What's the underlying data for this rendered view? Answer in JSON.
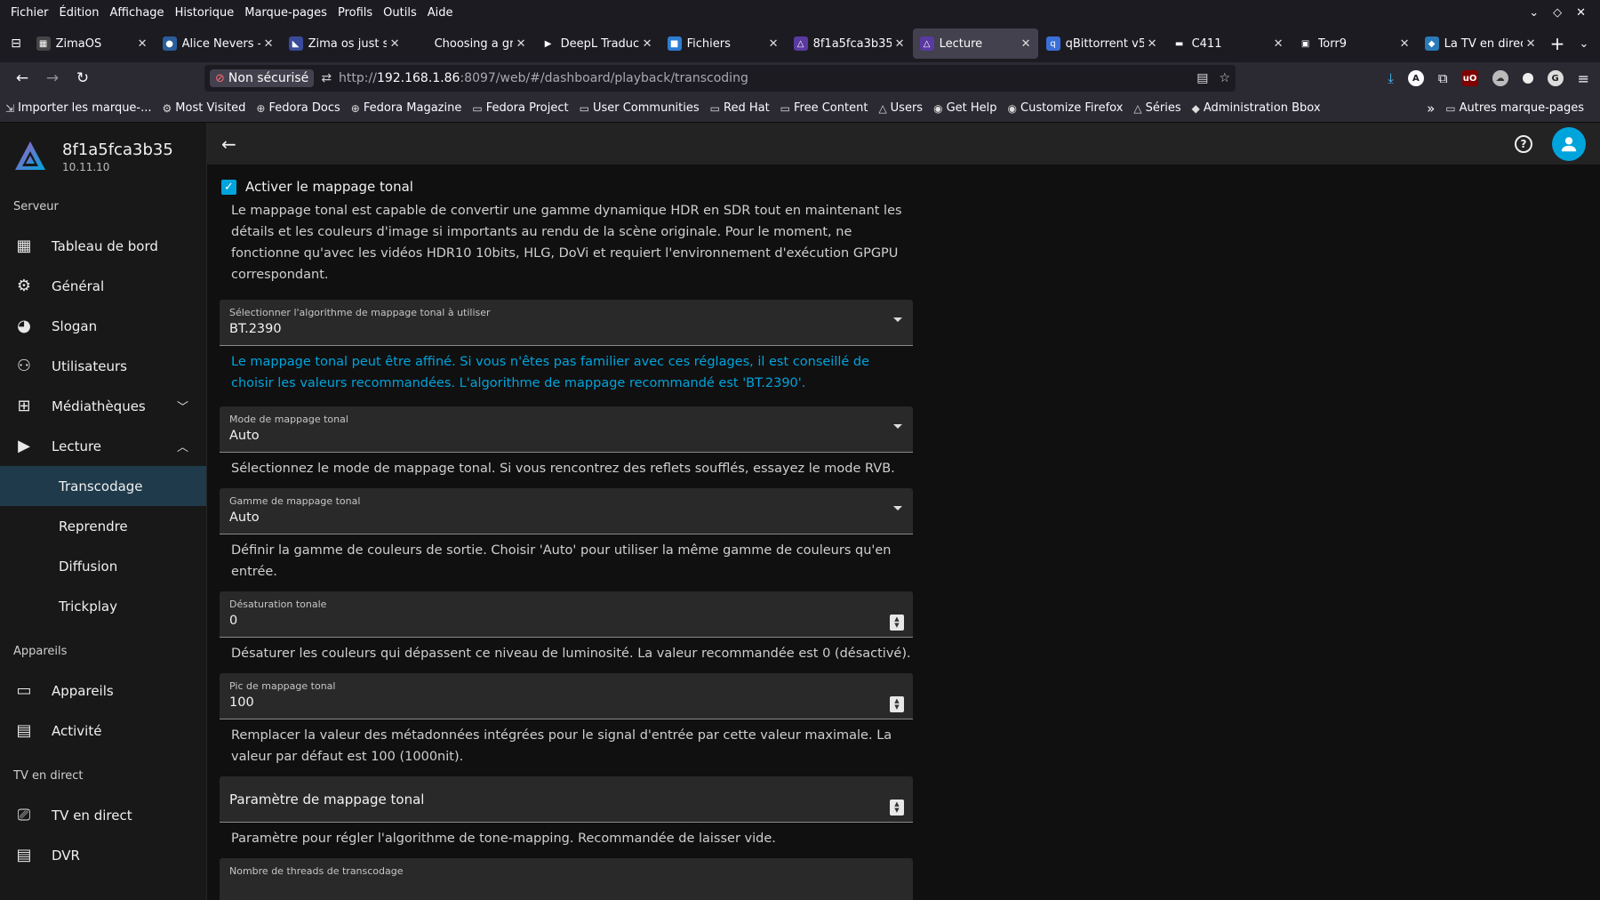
{
  "menubar": [
    "Fichier",
    "Édition",
    "Affichage",
    "Historique",
    "Marque-pages",
    "Profils",
    "Outils",
    "Aide"
  ],
  "tabs": [
    {
      "title": "ZimaOS",
      "fav_color": "#444",
      "fav_glyph": "▦",
      "active": false
    },
    {
      "title": "Alice Nevers -",
      "fav_color": "#2a5d9a",
      "fav_glyph": "●",
      "active": false
    },
    {
      "title": "Zima os just s",
      "fav_color": "#3a4a9a",
      "fav_glyph": "◣",
      "active": false
    },
    {
      "title": "Choosing a gr",
      "fav_color": "#1c1b22",
      "fav_glyph": "",
      "active": false
    },
    {
      "title": "DeepL Traduc",
      "fav_color": "#1c1b22",
      "fav_glyph": "▶",
      "active": false
    },
    {
      "title": "Fichiers",
      "fav_color": "#2d7dd2",
      "fav_glyph": "■",
      "active": false
    },
    {
      "title": "8f1a5fca3b35",
      "fav_color": "#5a3aa0",
      "fav_glyph": "△",
      "active": false
    },
    {
      "title": "Lecture",
      "fav_color": "#5a3aa0",
      "fav_glyph": "△",
      "active": true
    },
    {
      "title": "qBittorrent v5",
      "fav_color": "#3a6fd8",
      "fav_glyph": "q",
      "active": false
    },
    {
      "title": "C411",
      "fav_color": "#1c1b22",
      "fav_glyph": "▬",
      "active": false
    },
    {
      "title": "Torr9",
      "fav_color": "#1c1b22",
      "fav_glyph": "▣",
      "active": false
    },
    {
      "title": "La TV en direc",
      "fav_color": "#2a7ab8",
      "fav_glyph": "◆",
      "active": false
    }
  ],
  "navbar": {
    "insecure_label": "Non sécurisé",
    "url_prefix": "http://",
    "url_host": "192.168.1.86",
    "url_rest": ":8097/web/#/dashboard/playback/transcoding"
  },
  "bookmarks": [
    {
      "label": "Importer les marque-...",
      "icon": "⇲"
    },
    {
      "label": "Most Visited",
      "icon": "⚙"
    },
    {
      "label": "Fedora Docs",
      "icon": "⊕"
    },
    {
      "label": "Fedora Magazine",
      "icon": "⊕"
    },
    {
      "label": "Fedora Project",
      "icon": "▭"
    },
    {
      "label": "User Communities",
      "icon": "▭"
    },
    {
      "label": "Red Hat",
      "icon": "▭"
    },
    {
      "label": "Free Content",
      "icon": "▭"
    },
    {
      "label": "Users",
      "icon": "△"
    },
    {
      "label": "Get Help",
      "icon": "◉"
    },
    {
      "label": "Customize Firefox",
      "icon": "◉"
    },
    {
      "label": "Séries",
      "icon": "△"
    },
    {
      "label": "Administration Bbox",
      "icon": "◆"
    }
  ],
  "bookmarks_other": "Autres marque-pages",
  "server": {
    "name": "8f1a5fca3b35",
    "version": "10.11.10"
  },
  "sidebar": {
    "section_server": "Serveur",
    "items": [
      {
        "label": "Tableau de bord",
        "icon": "▦"
      },
      {
        "label": "Général",
        "icon": "⚙"
      },
      {
        "label": "Slogan",
        "icon": "🎨"
      },
      {
        "label": "Utilisateurs",
        "icon": "👥"
      },
      {
        "label": "Médiathèques",
        "icon": "⊞"
      },
      {
        "label": "Lecture",
        "icon": "▶"
      }
    ],
    "sub_items": [
      "Transcodage",
      "Reprendre",
      "Diffusion",
      "Trickplay"
    ],
    "section_devices": "Appareils",
    "device_items": [
      {
        "label": "Appareils",
        "icon": "▭"
      },
      {
        "label": "Activité",
        "icon": "▤"
      }
    ],
    "section_tv": "TV en direct",
    "tv_items": [
      {
        "label": "TV en direct",
        "icon": "📺"
      },
      {
        "label": "DVR",
        "icon": "▤"
      }
    ]
  },
  "content": {
    "checkbox_label": "Activer le mappage tonal",
    "checkbox_desc": "Le mappage tonal est capable de convertir une gamme dynamique HDR en SDR tout en maintenant les détails et les couleurs d'image si importants au rendu de la scène originale. Pour le moment, ne fonctionne qu'avec les vidéos HDR10 10bits, HLG, DoVi et requiert l'environnement d'exécution GPGPU correspondant.",
    "algo_label": "Sélectionner l'algorithme de mappage tonal à utiliser",
    "algo_value": "BT.2390",
    "algo_help": "Le mappage tonal peut être affiné. Si vous n'êtes pas familier avec ces réglages, il est conseillé de choisir les valeurs recommandées. L'algorithme de mappage recommandé est 'BT.2390'.",
    "mode_label": "Mode de mappage tonal",
    "mode_value": "Auto",
    "mode_help": "Sélectionnez le mode de mappage tonal. Si vous rencontrez des reflets soufflés, essayez le mode RVB.",
    "range_label": "Gamme de mappage tonal",
    "range_value": "Auto",
    "range_help": "Définir la gamme de couleurs de sortie. Choisir 'Auto' pour utiliser la même gamme de couleurs qu'en entrée.",
    "desat_label": "Désaturation tonale",
    "desat_value": "0",
    "desat_help": "Désaturer les couleurs qui dépassent ce niveau de luminosité. La valeur recommandée est 0 (désactivé).",
    "peak_label": "Pic de mappage tonal",
    "peak_value": "100",
    "peak_help": "Remplacer la valeur des métadonnées intégrées pour le signal d'entrée par cette valeur maximale. La valeur par défaut est 100 (1000nit).",
    "param_placeholder": "Paramètre de mappage tonal",
    "param_help": "Paramètre pour régler l'algorithme de tone-mapping. Recommandée de laisser vide.",
    "threads_label": "Nombre de threads de transcodage"
  },
  "colors": {
    "accent": "#00a4dc",
    "sidebar_selected": "#1f3a4a"
  }
}
